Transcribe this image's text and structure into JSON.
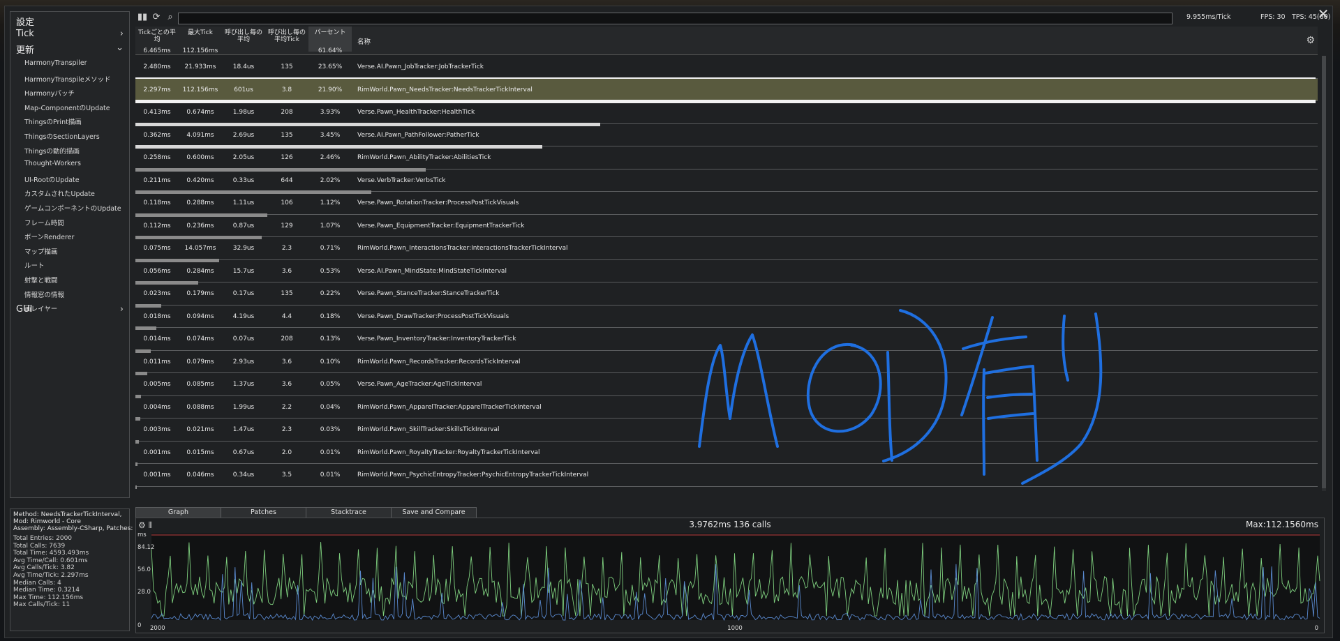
{
  "sidebar": {
    "settings_label": "設定",
    "tick_label": "Tick",
    "update_label": "更新",
    "gui_label": "GUI",
    "update_items": [
      "HarmonyTranspiler",
      "HarmonyTranspileメソッド",
      "Harmonyパッチ",
      "Map-ComponentのUpdate",
      "ThingsのPrint描画",
      "ThingsのSectionLayers",
      "Thingsの動的描画",
      "Thought-Workers",
      "UI-RootのUpdate",
      "カスタムされたUpdate",
      "ゲームコンポーネントのUpdate",
      "フレーム時間",
      "ボーンRenderer",
      "マップ描画",
      "ルート",
      "射撃と戦闘",
      "情報窓の情報",
      "画レイヤー"
    ]
  },
  "topbar": {
    "frame_time": "9.955ms/Tick",
    "fps": "FPS: 30",
    "tps": "TPS: 45(60)"
  },
  "table": {
    "headers": {
      "avg_per_tick": "Tickごとの平均",
      "max_tick": "最大Tick",
      "avg_per_call": "呼び出し毎の平均",
      "calls_per_tick": "呼び出し毎の平均Tick",
      "percent": "パーセント",
      "name": "名称"
    },
    "header_values": {
      "avg_per_tick": "6.465ms",
      "max_tick": "112.156ms",
      "percent": "61.64%"
    },
    "rows": [
      {
        "avg": "2.480ms",
        "max": "21.933ms",
        "per_call": "18.4us",
        "calls": "135",
        "pct": "23.65%",
        "name": "Verse.AI.Pawn_JobTracker:JobTrackerTick",
        "bar": 1.0
      },
      {
        "avg": "2.297ms",
        "max": "112.156ms",
        "per_call": "601us",
        "calls": "3.8",
        "pct": "21.90%",
        "name": "RimWorld.Pawn_NeedsTracker:NeedsTrackerTickInterval",
        "bar": 1.0
      },
      {
        "avg": "0.413ms",
        "max": "0.674ms",
        "per_call": "1.98us",
        "calls": "208",
        "pct": "3.93%",
        "name": "Verse.Pawn_HealthTracker:HealthTick",
        "bar": 0.394
      },
      {
        "avg": "0.362ms",
        "max": "4.091ms",
        "per_call": "2.69us",
        "calls": "135",
        "pct": "3.45%",
        "name": "Verse.AI.Pawn_PathFollower:PatherTick",
        "bar": 0.345
      },
      {
        "avg": "0.258ms",
        "max": "0.600ms",
        "per_call": "2.05us",
        "calls": "126",
        "pct": "2.46%",
        "name": "RimWorld.Pawn_AbilityTracker:AbilitiesTick",
        "bar": 0.246
      },
      {
        "avg": "0.211ms",
        "max": "0.420ms",
        "per_call": "0.33us",
        "calls": "644",
        "pct": "2.02%",
        "name": "Verse.VerbTracker:VerbsTick",
        "bar": 0.2
      },
      {
        "avg": "0.118ms",
        "max": "0.288ms",
        "per_call": "1.11us",
        "calls": "106",
        "pct": "1.12%",
        "name": "Verse.Pawn_RotationTracker:ProcessPostTickVisuals",
        "bar": 0.112
      },
      {
        "avg": "0.112ms",
        "max": "0.236ms",
        "per_call": "0.87us",
        "calls": "129",
        "pct": "1.07%",
        "name": "Verse.Pawn_EquipmentTracker:EquipmentTrackerTick",
        "bar": 0.107
      },
      {
        "avg": "0.075ms",
        "max": "14.057ms",
        "per_call": "32.9us",
        "calls": "2.3",
        "pct": "0.71%",
        "name": "RimWorld.Pawn_InteractionsTracker:InteractionsTrackerTickInterval",
        "bar": 0.071
      },
      {
        "avg": "0.056ms",
        "max": "0.284ms",
        "per_call": "15.7us",
        "calls": "3.6",
        "pct": "0.53%",
        "name": "Verse.AI.Pawn_MindState:MindStateTickInterval",
        "bar": 0.053
      },
      {
        "avg": "0.023ms",
        "max": "0.179ms",
        "per_call": "0.17us",
        "calls": "135",
        "pct": "0.22%",
        "name": "Verse.Pawn_StanceTracker:StanceTrackerTick",
        "bar": 0.022
      },
      {
        "avg": "0.018ms",
        "max": "0.094ms",
        "per_call": "4.19us",
        "calls": "4.4",
        "pct": "0.18%",
        "name": "Verse.Pawn_DrawTracker:ProcessPostTickVisuals",
        "bar": 0.018
      },
      {
        "avg": "0.014ms",
        "max": "0.074ms",
        "per_call": "0.07us",
        "calls": "208",
        "pct": "0.13%",
        "name": "Verse.Pawn_InventoryTracker:InventoryTrackerTick",
        "bar": 0.013
      },
      {
        "avg": "0.011ms",
        "max": "0.079ms",
        "per_call": "2.93us",
        "calls": "3.6",
        "pct": "0.10%",
        "name": "RimWorld.Pawn_RecordsTracker:RecordsTickInterval",
        "bar": 0.01
      },
      {
        "avg": "0.005ms",
        "max": "0.085ms",
        "per_call": "1.37us",
        "calls": "3.6",
        "pct": "0.05%",
        "name": "Verse.Pawn_AgeTracker:AgeTickInterval",
        "bar": 0.005
      },
      {
        "avg": "0.004ms",
        "max": "0.088ms",
        "per_call": "1.99us",
        "calls": "2.2",
        "pct": "0.04%",
        "name": "RimWorld.Pawn_ApparelTracker:ApparelTrackerTickInterval",
        "bar": 0.004
      },
      {
        "avg": "0.003ms",
        "max": "0.021ms",
        "per_call": "1.47us",
        "calls": "2.3",
        "pct": "0.03%",
        "name": "RimWorld.Pawn_SkillTracker:SkillsTickInterval",
        "bar": 0.003
      },
      {
        "avg": "0.001ms",
        "max": "0.015ms",
        "per_call": "0.67us",
        "calls": "2.0",
        "pct": "0.01%",
        "name": "RimWorld.Pawn_RoyaltyTracker:RoyaltyTrackerTickInterval",
        "bar": 0.001
      },
      {
        "avg": "0.001ms",
        "max": "0.046ms",
        "per_call": "0.34us",
        "calls": "3.5",
        "pct": "0.01%",
        "name": "RimWorld.Pawn_PsychicEntropyTracker:PsychicEntropyTrackerTickInterval",
        "bar": 0
      }
    ]
  },
  "details": {
    "method": "Method: NeedsTrackerTickInterval,",
    "mod": "Mod: Rimworld - Core",
    "assembly": "Assembly: Assembly-CSharp, Patches: 1",
    "stats": [
      "Total Entries: 2000",
      "Total Calls: 7639",
      "Total Time: 4593.493ms",
      "Avg Time/Call: 0.601ms",
      "Avg Calls/Tick: 3.82",
      "Avg Time/Tick: 2.297ms",
      "Median Calls: 4",
      "Median Time: 0.3214",
      "Max Time: 112.156ms",
      "Max Calls/Tick: 11"
    ]
  },
  "bottom_tabs": [
    "Graph",
    "Patches",
    "Stacktrace",
    "Save and Compare"
  ],
  "graph": {
    "title": "3.9762ms 136 calls",
    "max_label": "Max:112.1560ms",
    "y_unit": "ms",
    "y_ticks": [
      "84.12",
      "56.0",
      "28.0",
      "0"
    ],
    "x_ticks": [
      "2000",
      "1000",
      "0"
    ]
  },
  "overlay": {
    "handwritten_text": "MOD有り"
  },
  "colors": {
    "highlight_row": "#595a3e",
    "graph_green": "#7fd07f",
    "graph_blue": "#5a8ad0",
    "graph_red_line": "#c04040",
    "handwriting_blue": "#1f6fe0"
  }
}
